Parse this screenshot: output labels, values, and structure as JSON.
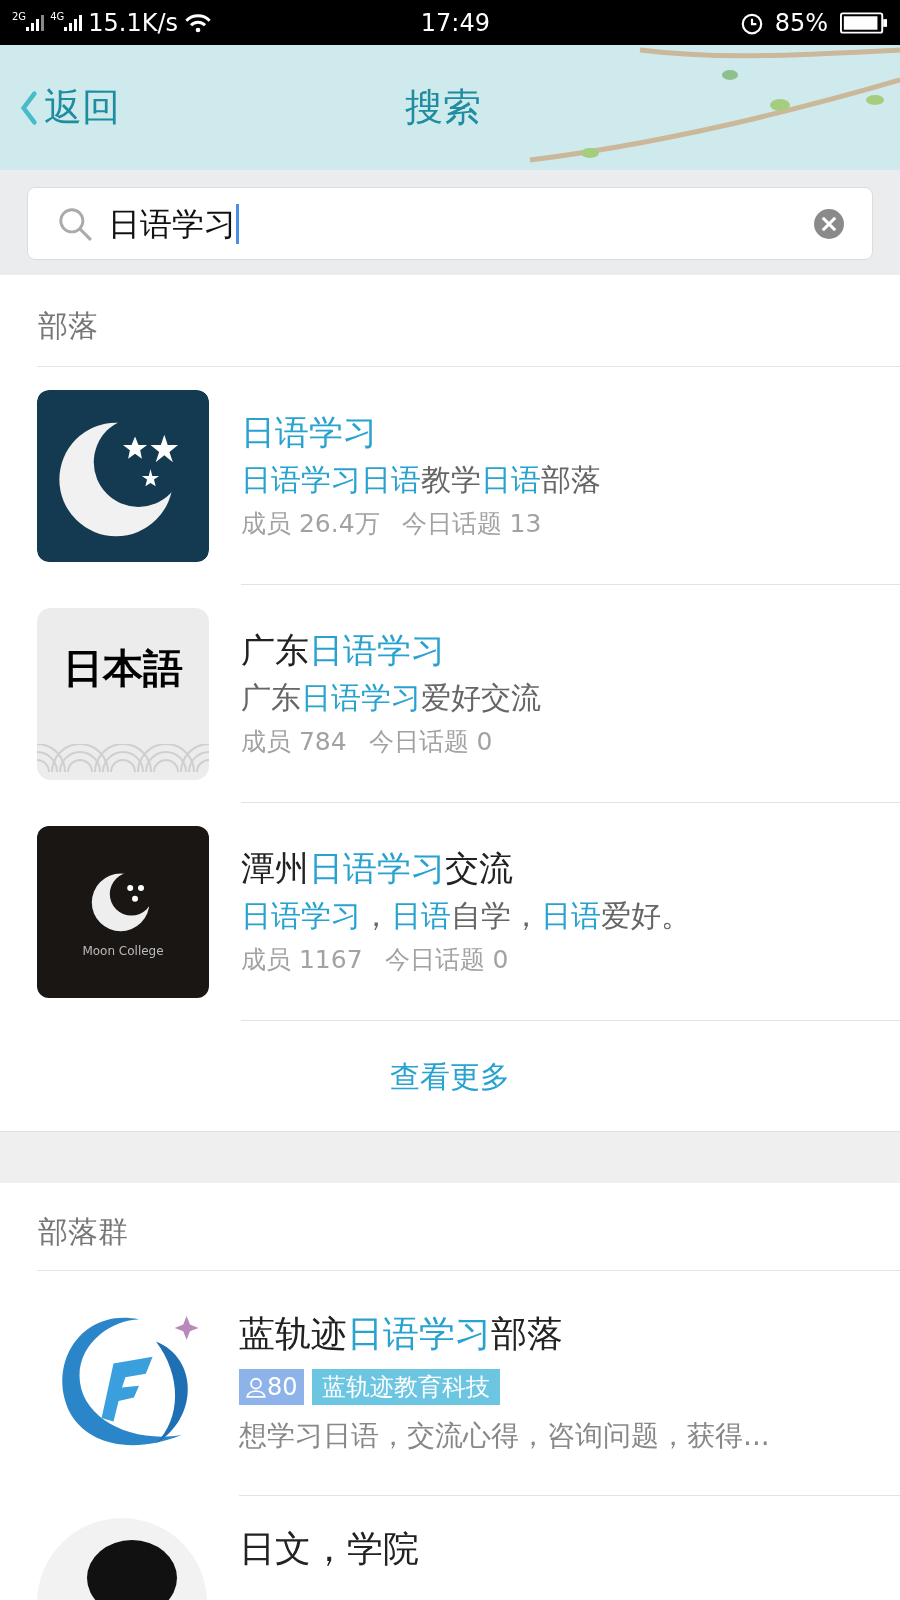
{
  "status_bar": {
    "signal_1": "2G",
    "signal_2": "4G",
    "speed": "15.1K/s",
    "time": "17:49",
    "battery": "85%"
  },
  "nav": {
    "back": "返回",
    "title": "搜索"
  },
  "search": {
    "value": "日语学习"
  },
  "tribes": {
    "heading": "部落",
    "items": [
      {
        "avatar": {
          "kind": "moon"
        },
        "title": [
          {
            "text": "日语学习",
            "highlight": true
          }
        ],
        "subtitle": [
          {
            "text": "日语学习日语",
            "highlight": true
          },
          {
            "text": "教学",
            "highlight": false
          },
          {
            "text": "日语",
            "highlight": true
          },
          {
            "text": "部落",
            "highlight": false
          }
        ],
        "members": "成员 26.4万",
        "topics": "今日话题 13"
      },
      {
        "avatar": {
          "kind": "calligraphy",
          "caption": "日本語"
        },
        "title": [
          {
            "text": "广东",
            "highlight": false
          },
          {
            "text": "日语学习",
            "highlight": true
          }
        ],
        "subtitle": [
          {
            "text": "广东",
            "highlight": false
          },
          {
            "text": "日语学习",
            "highlight": true
          },
          {
            "text": "爱好交流",
            "highlight": false
          }
        ],
        "members": "成员 784",
        "topics": "今日话题 0"
      },
      {
        "avatar": {
          "kind": "moon-dark",
          "caption": "Moon College"
        },
        "title": [
          {
            "text": "潭州",
            "highlight": false
          },
          {
            "text": "日语学习",
            "highlight": true
          },
          {
            "text": "交流",
            "highlight": false
          }
        ],
        "subtitle": [
          {
            "text": "日语学习",
            "highlight": true
          },
          {
            "text": "，",
            "highlight": false
          },
          {
            "text": "日语",
            "highlight": true
          },
          {
            "text": "自学，",
            "highlight": false
          },
          {
            "text": "日语",
            "highlight": true
          },
          {
            "text": "爱好。",
            "highlight": false
          }
        ],
        "members": "成员 1167",
        "topics": "今日话题 0"
      }
    ],
    "more": "查看更多"
  },
  "groups": {
    "heading": "部落群",
    "items": [
      {
        "avatar": {
          "kind": "swirl"
        },
        "title": [
          {
            "text": "蓝轨迹",
            "highlight": false
          },
          {
            "text": "日语学习",
            "highlight": true
          },
          {
            "text": "部落",
            "highlight": false
          }
        ],
        "member_count": "80",
        "tag": "蓝轨迹教育科技",
        "description": "想学习日语，交流心得，咨询问题，获得..."
      },
      {
        "avatar": {
          "kind": "picture"
        },
        "title": [
          {
            "text": "日文，学院",
            "highlight": false
          }
        ]
      }
    ]
  }
}
